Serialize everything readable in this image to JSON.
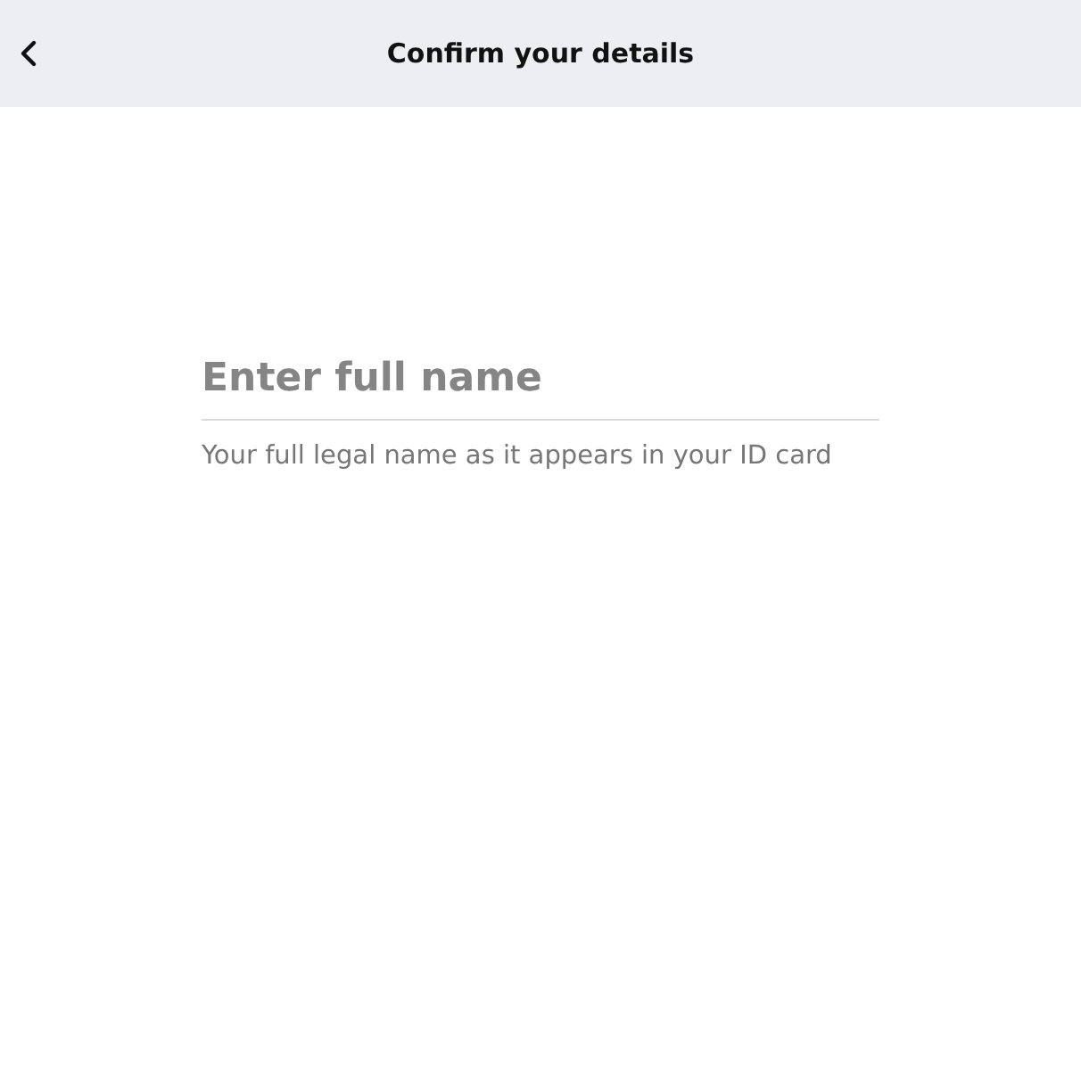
{
  "header": {
    "title": "Confirm your details"
  },
  "name_field": {
    "placeholder": "Enter full name",
    "hint": "Your full legal name as it appears in your ID card"
  }
}
